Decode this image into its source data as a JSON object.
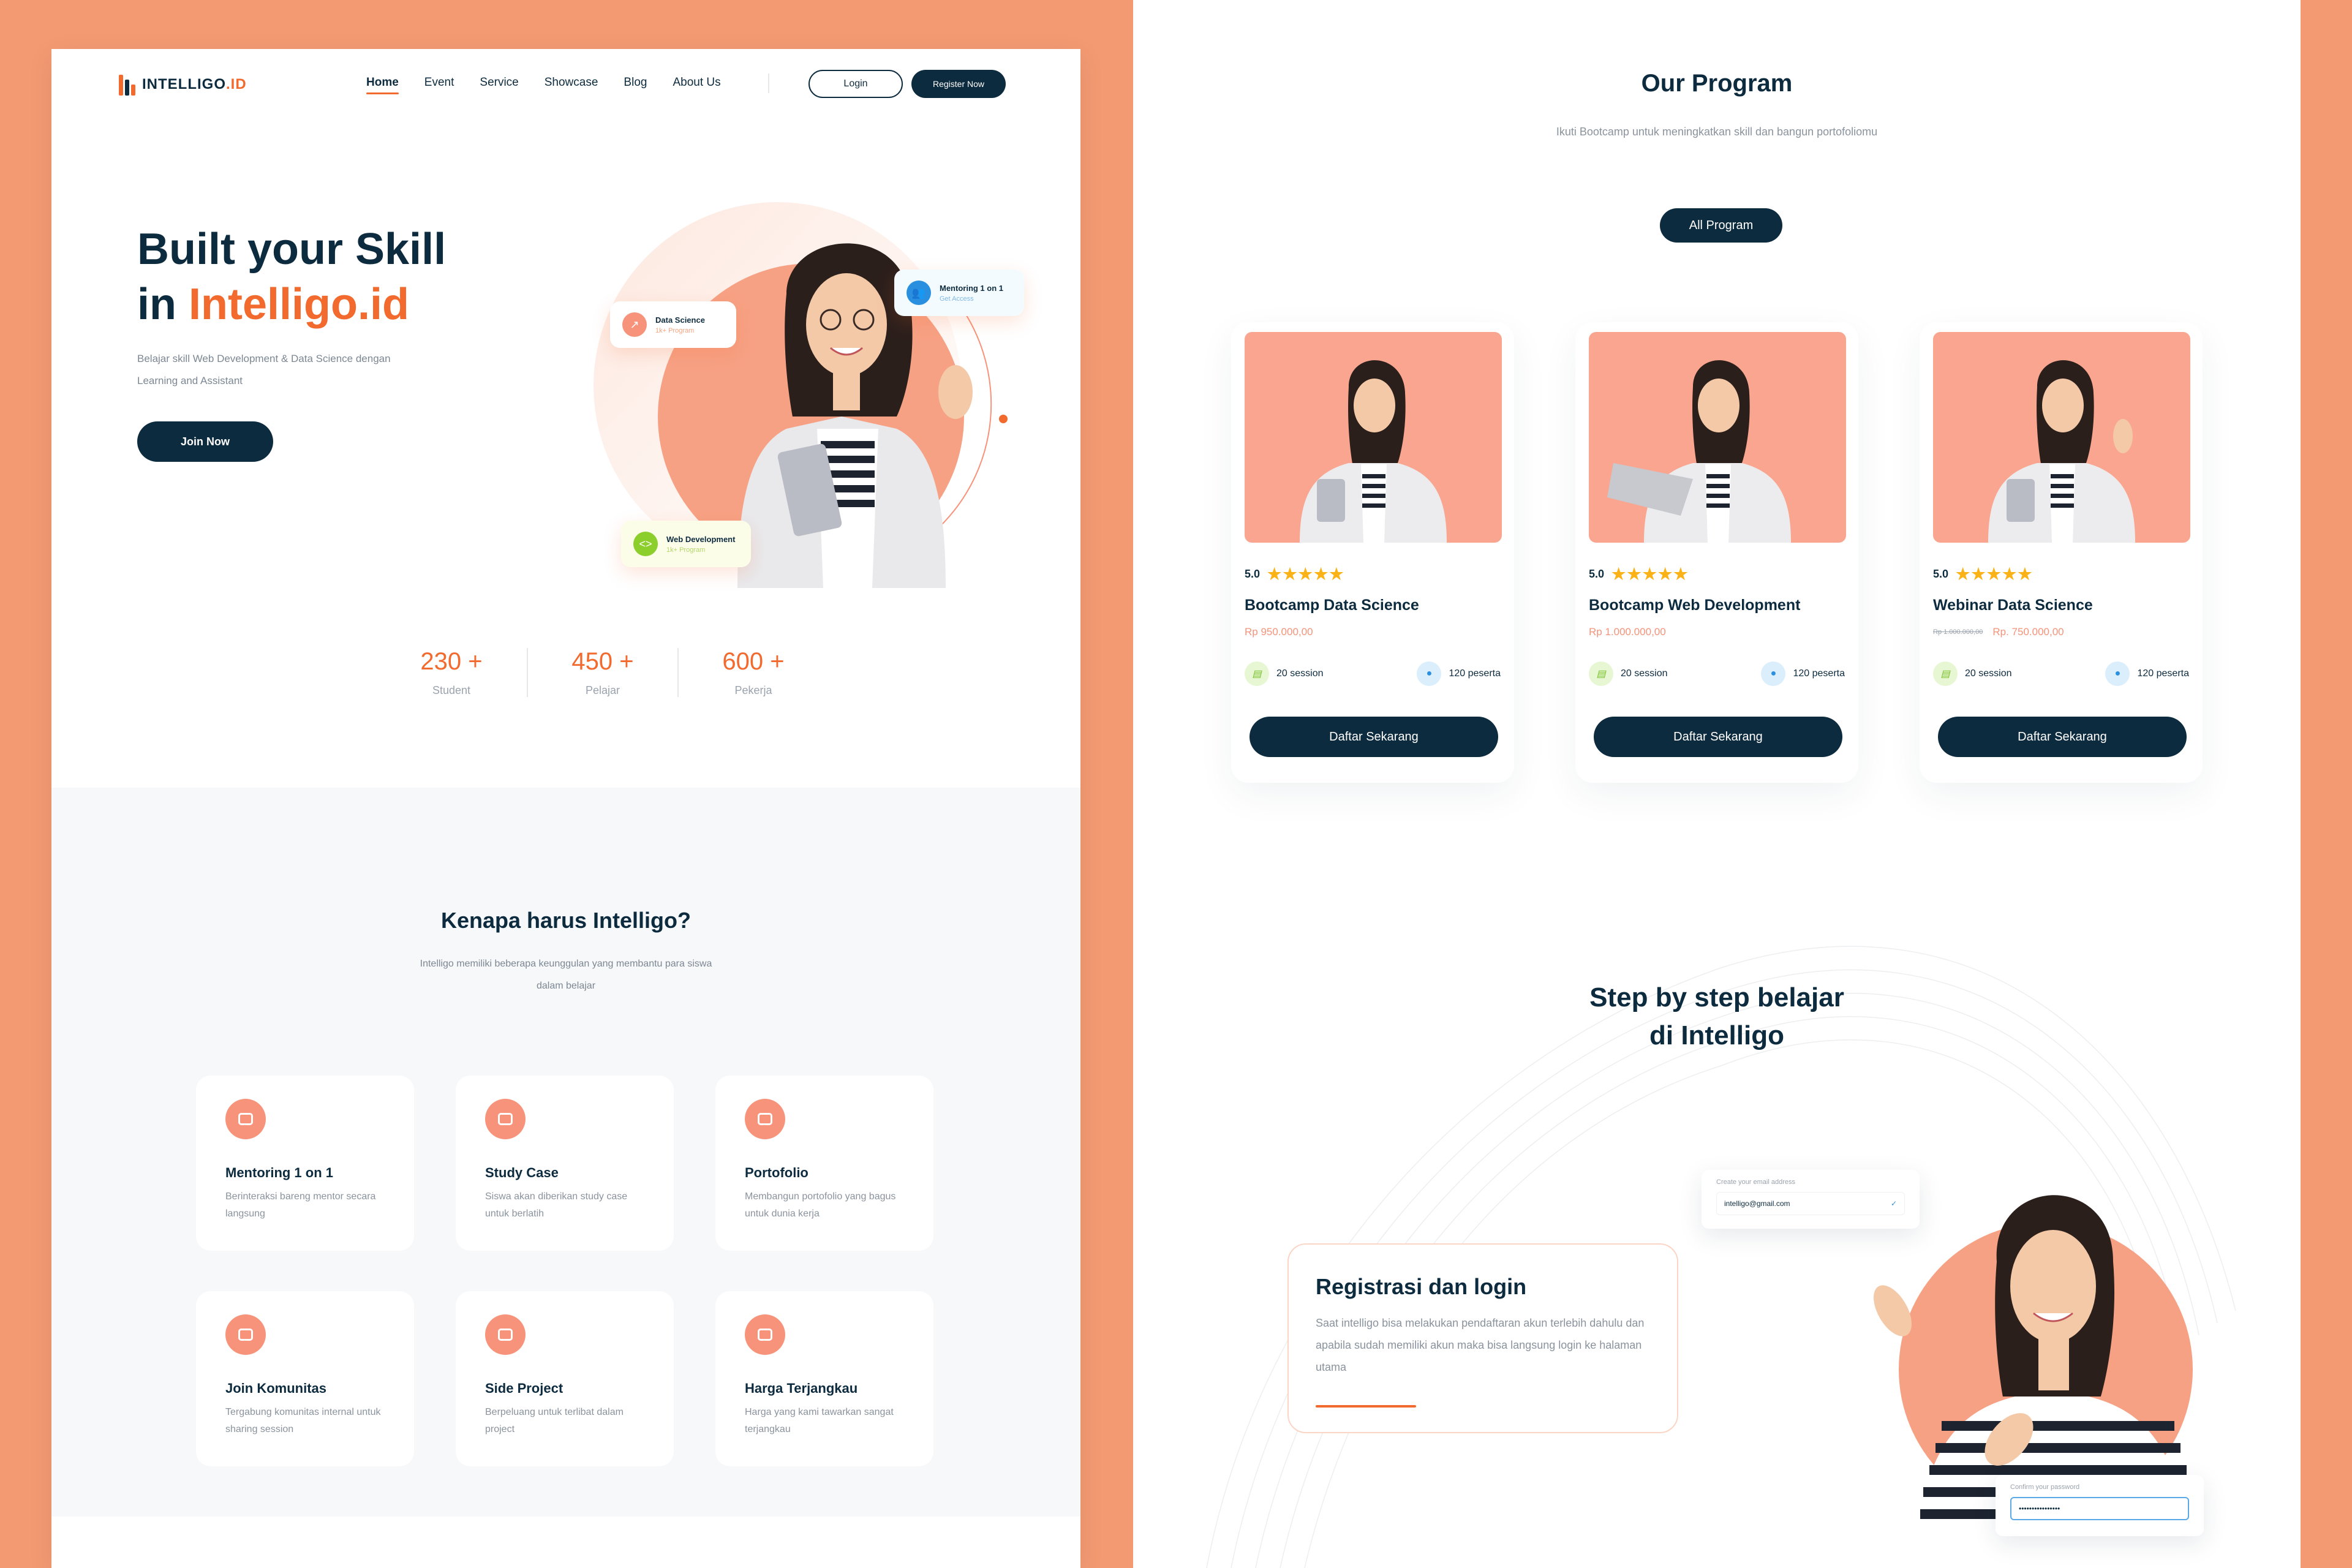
{
  "colors": {
    "accent": "#f26a2e",
    "navy": "#0d2b3e",
    "peach": "#f9a58f",
    "background": "#f39a72"
  },
  "nav": {
    "logo_main": "INTELLIGO",
    "logo_suffix": ".ID",
    "links": [
      "Home",
      "Event",
      "Service",
      "Showcase",
      "Blog",
      "About Us"
    ],
    "login": "Login",
    "register": "Register Now"
  },
  "hero": {
    "title_line1": "Built your Skill",
    "title_in": "in ",
    "title_brand": "Intelligo.id",
    "subtitle": "Belajar skill Web Development & Data Science dengan Learning and Assistant",
    "cta": "Join Now",
    "badge_data_science": "Data Science",
    "badge_data_science_sub": "1k+ Program",
    "badge_mentoring": "Mentoring 1 on 1",
    "badge_mentoring_sub": "Get Access",
    "badge_webdev": "Web Development",
    "badge_webdev_sub": "1k+ Program"
  },
  "stats": [
    {
      "value": "230 +",
      "label": "Student"
    },
    {
      "value": "450 +",
      "label": "Pelajar"
    },
    {
      "value": "600 +",
      "label": "Pekerja"
    }
  ],
  "why": {
    "title": "Kenapa harus Intelligo?",
    "subtitle": "Intelligo memiliki beberapa keunggulan yang membantu para siswa dalam belajar",
    "features": [
      {
        "icon": "mentor-icon",
        "title": "Mentoring 1 on 1",
        "desc": "Berinteraksi bareng mentor secara langsung"
      },
      {
        "icon": "study-case-icon",
        "title": "Study Case",
        "desc": "Siswa akan diberikan study case untuk berlatih"
      },
      {
        "icon": "portfolio-icon",
        "title": "Portofolio",
        "desc": "Membangun portofolio yang bagus untuk dunia kerja"
      },
      {
        "icon": "community-icon",
        "title": "Join Komunitas",
        "desc": "Tergabung komunitas internal untuk sharing session"
      },
      {
        "icon": "project-icon",
        "title": "Side Project",
        "desc": "Berpeluang untuk terlibat dalam project"
      },
      {
        "icon": "price-icon",
        "title": "Harga Terjangkau",
        "desc": "Harga yang kami tawarkan sangat terjangkau"
      }
    ]
  },
  "program": {
    "title": "Our Program",
    "subtitle": "Ikuti Bootcamp untuk meningkatkan skill dan bangun portofoliomu",
    "all_button": "All Program",
    "courses": [
      {
        "rating": "5.0",
        "stars": "★★★★★",
        "title": "Bootcamp Data Science",
        "old_price": "",
        "price": "Rp 950.000,00",
        "sessions": "20 session",
        "participants": "120 peserta",
        "cta": "Daftar Sekarang"
      },
      {
        "rating": "5.0",
        "stars": "★★★★★",
        "title": "Bootcamp Web Development",
        "old_price": "",
        "price": "Rp 1.000.000,00",
        "sessions": "20 session",
        "participants": "120 peserta",
        "cta": "Daftar Sekarang"
      },
      {
        "rating": "5.0",
        "stars": "★★★★★",
        "title": "Webinar Data Science",
        "old_price": "Rp 1.000.000,00",
        "price": "Rp. 750.000,00",
        "sessions": "20 session",
        "participants": "120 peserta",
        "cta": "Daftar Sekarang"
      }
    ]
  },
  "steps": {
    "title_line1": "Step by step belajar",
    "title_line2": "di Intelligo",
    "card_title": "Registrasi dan login",
    "card_desc": "Saat intelligo bisa melakukan pendaftaran akun terlebih dahulu dan apabila sudah memiliki akun maka bisa langsung login ke halaman utama",
    "email_label": "Create your email address",
    "email_value": "intelligo@gmail.com",
    "password_label": "Confirm your password",
    "password_value": "••••••••••••••••"
  }
}
